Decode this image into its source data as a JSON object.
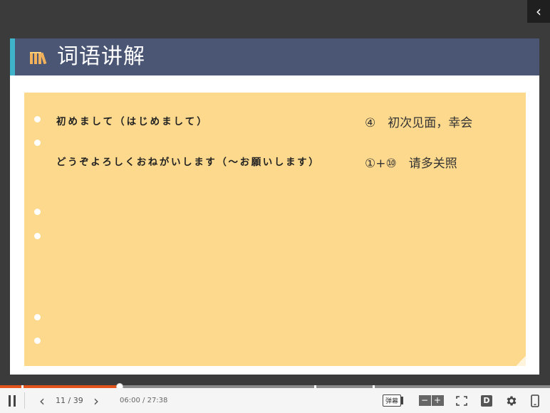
{
  "window": {
    "collapse_icon": "chevron-left-icon"
  },
  "slide": {
    "title": "词语讲解",
    "title_icon": "books-icon",
    "colors": {
      "header_bg": "#4a5673",
      "accent": "#3eb3c9",
      "content_bg": "#fdd98d"
    },
    "rows": [
      {
        "japanese": "初めまして（はじめまして）",
        "meaning": "④　初次见面，幸会"
      },
      {
        "japanese": "どうぞよろしくおねがいします（～お願いします）",
        "meaning": "①+⑩　请多关照"
      }
    ]
  },
  "player": {
    "progress_percent": 21.7,
    "page_current": "11",
    "page_separator": "/",
    "page_total": "39",
    "time_current": "06:00",
    "time_separator": "/",
    "time_total": "27:38",
    "danmu_label": "弹幕",
    "zoom_out_label": "−",
    "zoom_in_label": "+",
    "d_label": "D",
    "accent_color": "#e2541c"
  }
}
